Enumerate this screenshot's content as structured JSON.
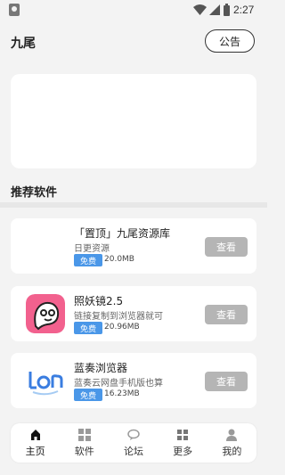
{
  "status_bar": {
    "time": "2:27"
  },
  "header": {
    "title": "九尾",
    "notice_label": "公告"
  },
  "section": {
    "title": "推荐软件"
  },
  "apps": [
    {
      "name": "「置顶」九尾资源库",
      "desc": "日更资源",
      "badge": "免费",
      "size": "20.0MB",
      "button": "查看"
    },
    {
      "name": "照妖镜2.5",
      "desc": "链接复制到浏览器就可",
      "badge": "免费",
      "size": "20.96MB",
      "button": "查看"
    },
    {
      "name": "蓝奏浏览器",
      "desc": "蓝奏云网盘手机版也算",
      "badge": "免费",
      "size": "16.23MB",
      "button": "查看"
    }
  ],
  "nav": [
    {
      "label": "主页",
      "icon": "home-icon"
    },
    {
      "label": "软件",
      "icon": "apps-icon"
    },
    {
      "label": "论坛",
      "icon": "chat-icon"
    },
    {
      "label": "更多",
      "icon": "more-icon"
    },
    {
      "label": "我的",
      "icon": "profile-icon"
    }
  ],
  "colors": {
    "free_badge": "#4a97e8",
    "view_button": "#b5b5b5"
  }
}
